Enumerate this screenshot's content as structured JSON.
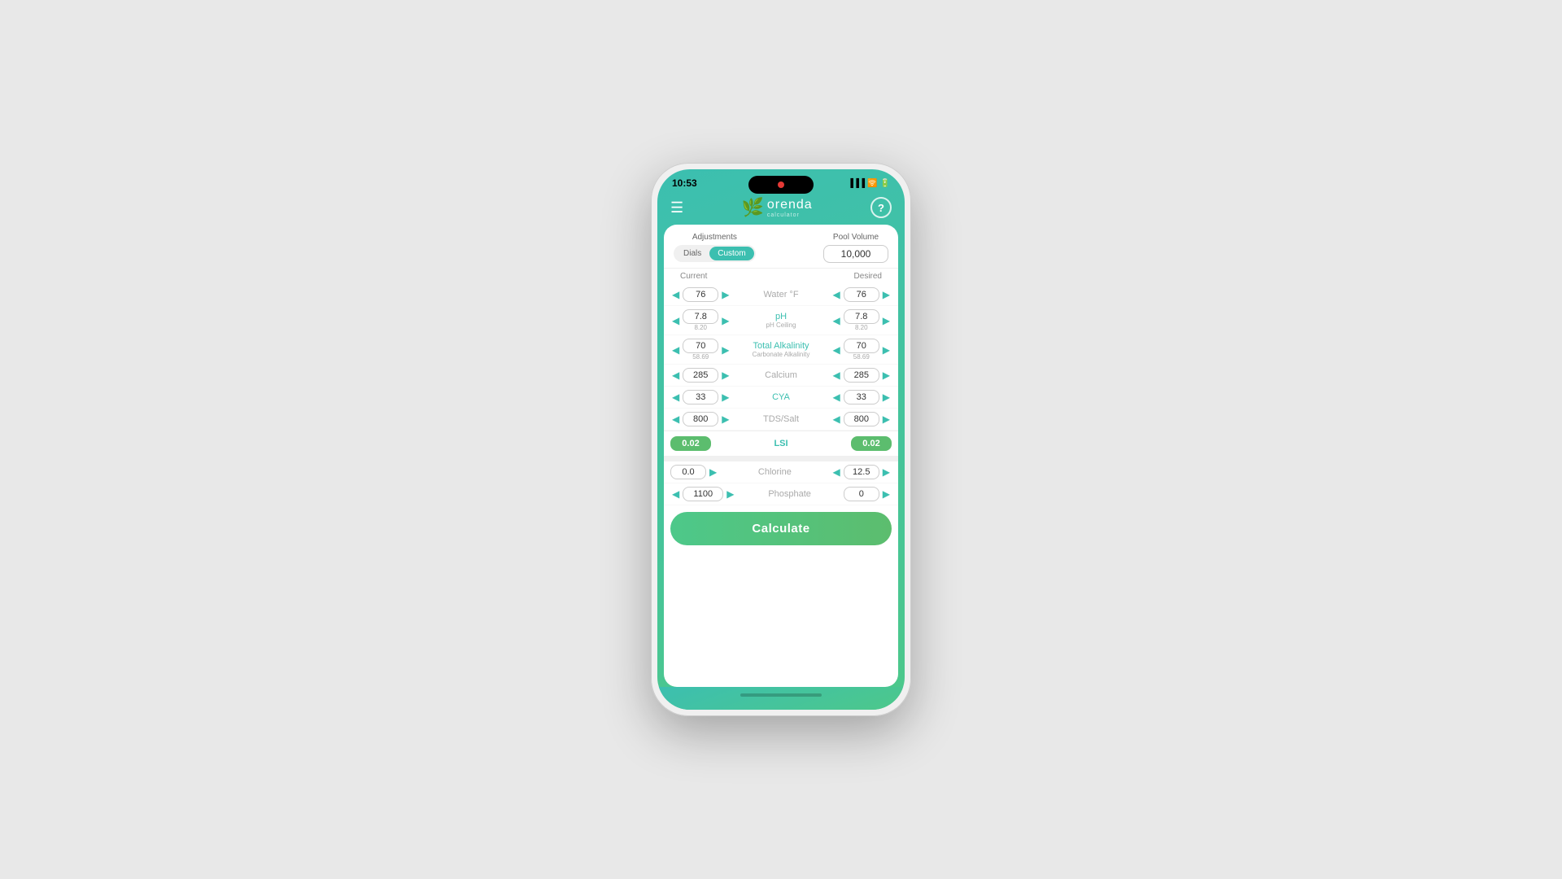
{
  "statusBar": {
    "time": "10:53",
    "icons": "signal wifi battery"
  },
  "header": {
    "menuIcon": "☰",
    "logoText": "orenda",
    "logoSub": "calculator",
    "helpIcon": "?"
  },
  "tabs": {
    "adjustmentsLabel": "Adjustments",
    "poolVolumeLabel": "Pool Volume",
    "dialsBtnLabel": "Dials",
    "customBtnLabel": "Custom",
    "activeTab": "Custom",
    "poolVolumeValue": "10,000"
  },
  "colHeaders": {
    "current": "Current",
    "desired": "Desired"
  },
  "params": [
    {
      "id": "water-temp",
      "name": "Water °F",
      "nameColor": "gray",
      "currentValue": "76",
      "desiredValue": "76",
      "currentSub": "",
      "desiredSub": ""
    },
    {
      "id": "ph",
      "name": "pH",
      "nameColor": "teal",
      "currentValue": "7.8",
      "desiredValue": "7.8",
      "currentSub": "8.20",
      "desiredSub": "8.20",
      "subLabel": "pH Ceiling"
    },
    {
      "id": "total-alkalinity",
      "name": "Total Alkalinity",
      "nameColor": "teal",
      "currentValue": "70",
      "desiredValue": "70",
      "currentSub": "58.69",
      "desiredSub": "58.69",
      "subLabel": "Carbonate Alkalinity"
    },
    {
      "id": "calcium",
      "name": "Calcium",
      "nameColor": "gray",
      "currentValue": "285",
      "desiredValue": "285",
      "currentSub": "",
      "desiredSub": ""
    },
    {
      "id": "cya",
      "name": "CYA",
      "nameColor": "teal",
      "currentValue": "33",
      "desiredValue": "33",
      "currentSub": "",
      "desiredSub": ""
    },
    {
      "id": "tds-salt",
      "name": "TDS/Salt",
      "nameColor": "gray",
      "currentValue": "800",
      "desiredValue": "800",
      "currentSub": "",
      "desiredSub": ""
    }
  ],
  "lsi": {
    "label": "LSI",
    "currentValue": "0.02",
    "desiredValue": "0.02"
  },
  "bottomParams": [
    {
      "id": "chlorine",
      "name": "Chlorine",
      "nameColor": "gray",
      "currentValue": "0.0",
      "desiredValue": "12.5",
      "hasLeftArrowCurrent": false,
      "hasRightArrowCurrent": true,
      "hasLeftArrowDesired": true,
      "hasRightArrowDesired": true
    },
    {
      "id": "phosphate",
      "name": "Phosphate",
      "nameColor": "gray",
      "currentValue": "1100",
      "desiredValue": "0",
      "hasLeftArrowCurrent": true,
      "hasRightArrowCurrent": true,
      "hasLeftArrowDesired": false,
      "hasRightArrowDesired": true
    }
  ],
  "calculateBtn": "Calculate",
  "arrows": {
    "left": "◀",
    "right": "▶"
  }
}
